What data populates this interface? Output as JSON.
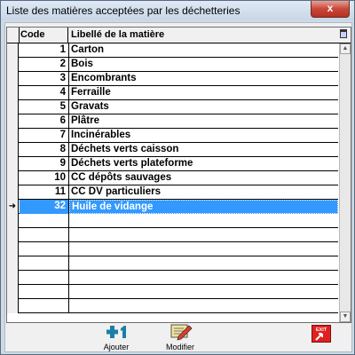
{
  "window": {
    "title": "Liste des matières acceptées par les déchetteries",
    "close_label": "x"
  },
  "table": {
    "columns": [
      "Code",
      "Libellé de la matière"
    ],
    "rows": [
      {
        "code": "1",
        "label": "Carton"
      },
      {
        "code": "2",
        "label": "Bois"
      },
      {
        "code": "3",
        "label": "Encombrants"
      },
      {
        "code": "4",
        "label": "Ferraille"
      },
      {
        "code": "5",
        "label": "Gravats"
      },
      {
        "code": "6",
        "label": "Plâtre"
      },
      {
        "code": "7",
        "label": "Incinérables"
      },
      {
        "code": "8",
        "label": "Déchets verts caisson"
      },
      {
        "code": "9",
        "label": "Déchets verts plateforme"
      },
      {
        "code": "10",
        "label": "CC dépôts sauvages"
      },
      {
        "code": "11",
        "label": "CC DV particuliers"
      },
      {
        "code": "32",
        "label": "Huile de vidange"
      }
    ],
    "selected_row": 11,
    "empty_rows": 7
  },
  "toolbar": {
    "add_label": "Ajouter",
    "edit_label": "Modifier",
    "exit_label": "EXIT"
  },
  "colors": {
    "selection": "#3399ff",
    "title_bar": "#cfd9e4",
    "close_button": "#c8473a"
  }
}
